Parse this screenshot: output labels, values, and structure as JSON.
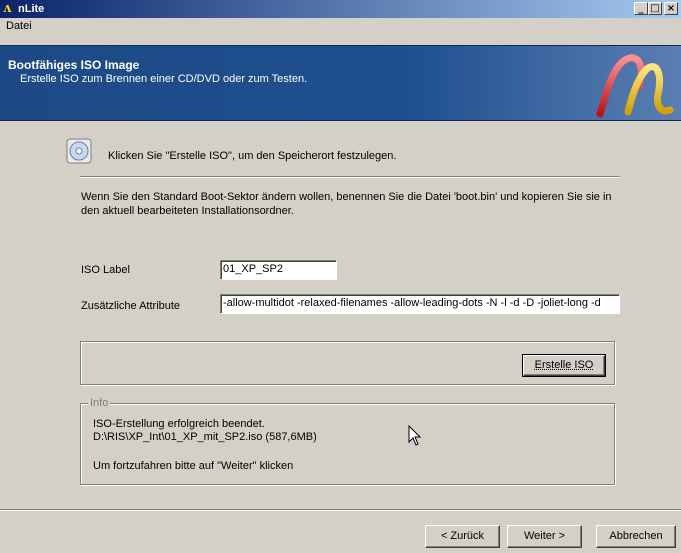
{
  "window": {
    "title": "nLite",
    "minimize_glyph": "_",
    "maximize_glyph": "□",
    "close_glyph": "×"
  },
  "menu": {
    "items": [
      "Datei"
    ]
  },
  "header": {
    "title": "Bootfähiges ISO Image",
    "subtitle": "Erstelle ISO zum Brennen einer CD/DVD oder zum Testen.",
    "logo": "nlite-logo-icon"
  },
  "main": {
    "hint_icon": "cd-disc-icon",
    "hint": "Klicken Sie \"Erstelle ISO\", um den Speicherort festzulegen.",
    "description": "Wenn Sie den Standard Boot-Sektor ändern wollen, benennen Sie die Datei 'boot.bin' und kopieren Sie sie in den aktuell bearbeiteten Installationsordner.",
    "iso_label_label": "ISO Label",
    "iso_label_value": "01_XP_SP2",
    "attributes_label": "Zusätzliche Attribute",
    "attributes_value": "-allow-multidot -relaxed-filenames -allow-leading-dots -N -l -d -D -joliet-long -d",
    "create_iso_button": "Erstelle ISO"
  },
  "info": {
    "legend": "Info",
    "line1": "ISO-Erstellung erfolgreich beendet.",
    "line2": "D:\\RIS\\XP_Int\\01_XP_mit_SP2.iso (587,6MB)",
    "line3": "Um fortzufahren bitte auf \"Weiter\" klicken"
  },
  "footer": {
    "back_button": "< Zurück",
    "next_button": "Weiter >",
    "cancel_button": "Abbrechen"
  },
  "colors": {
    "titlebar_start": "#0a246a",
    "titlebar_end": "#a6caf0",
    "banner": "#1f4f8f",
    "dialog_face": "#d4d0c8"
  }
}
